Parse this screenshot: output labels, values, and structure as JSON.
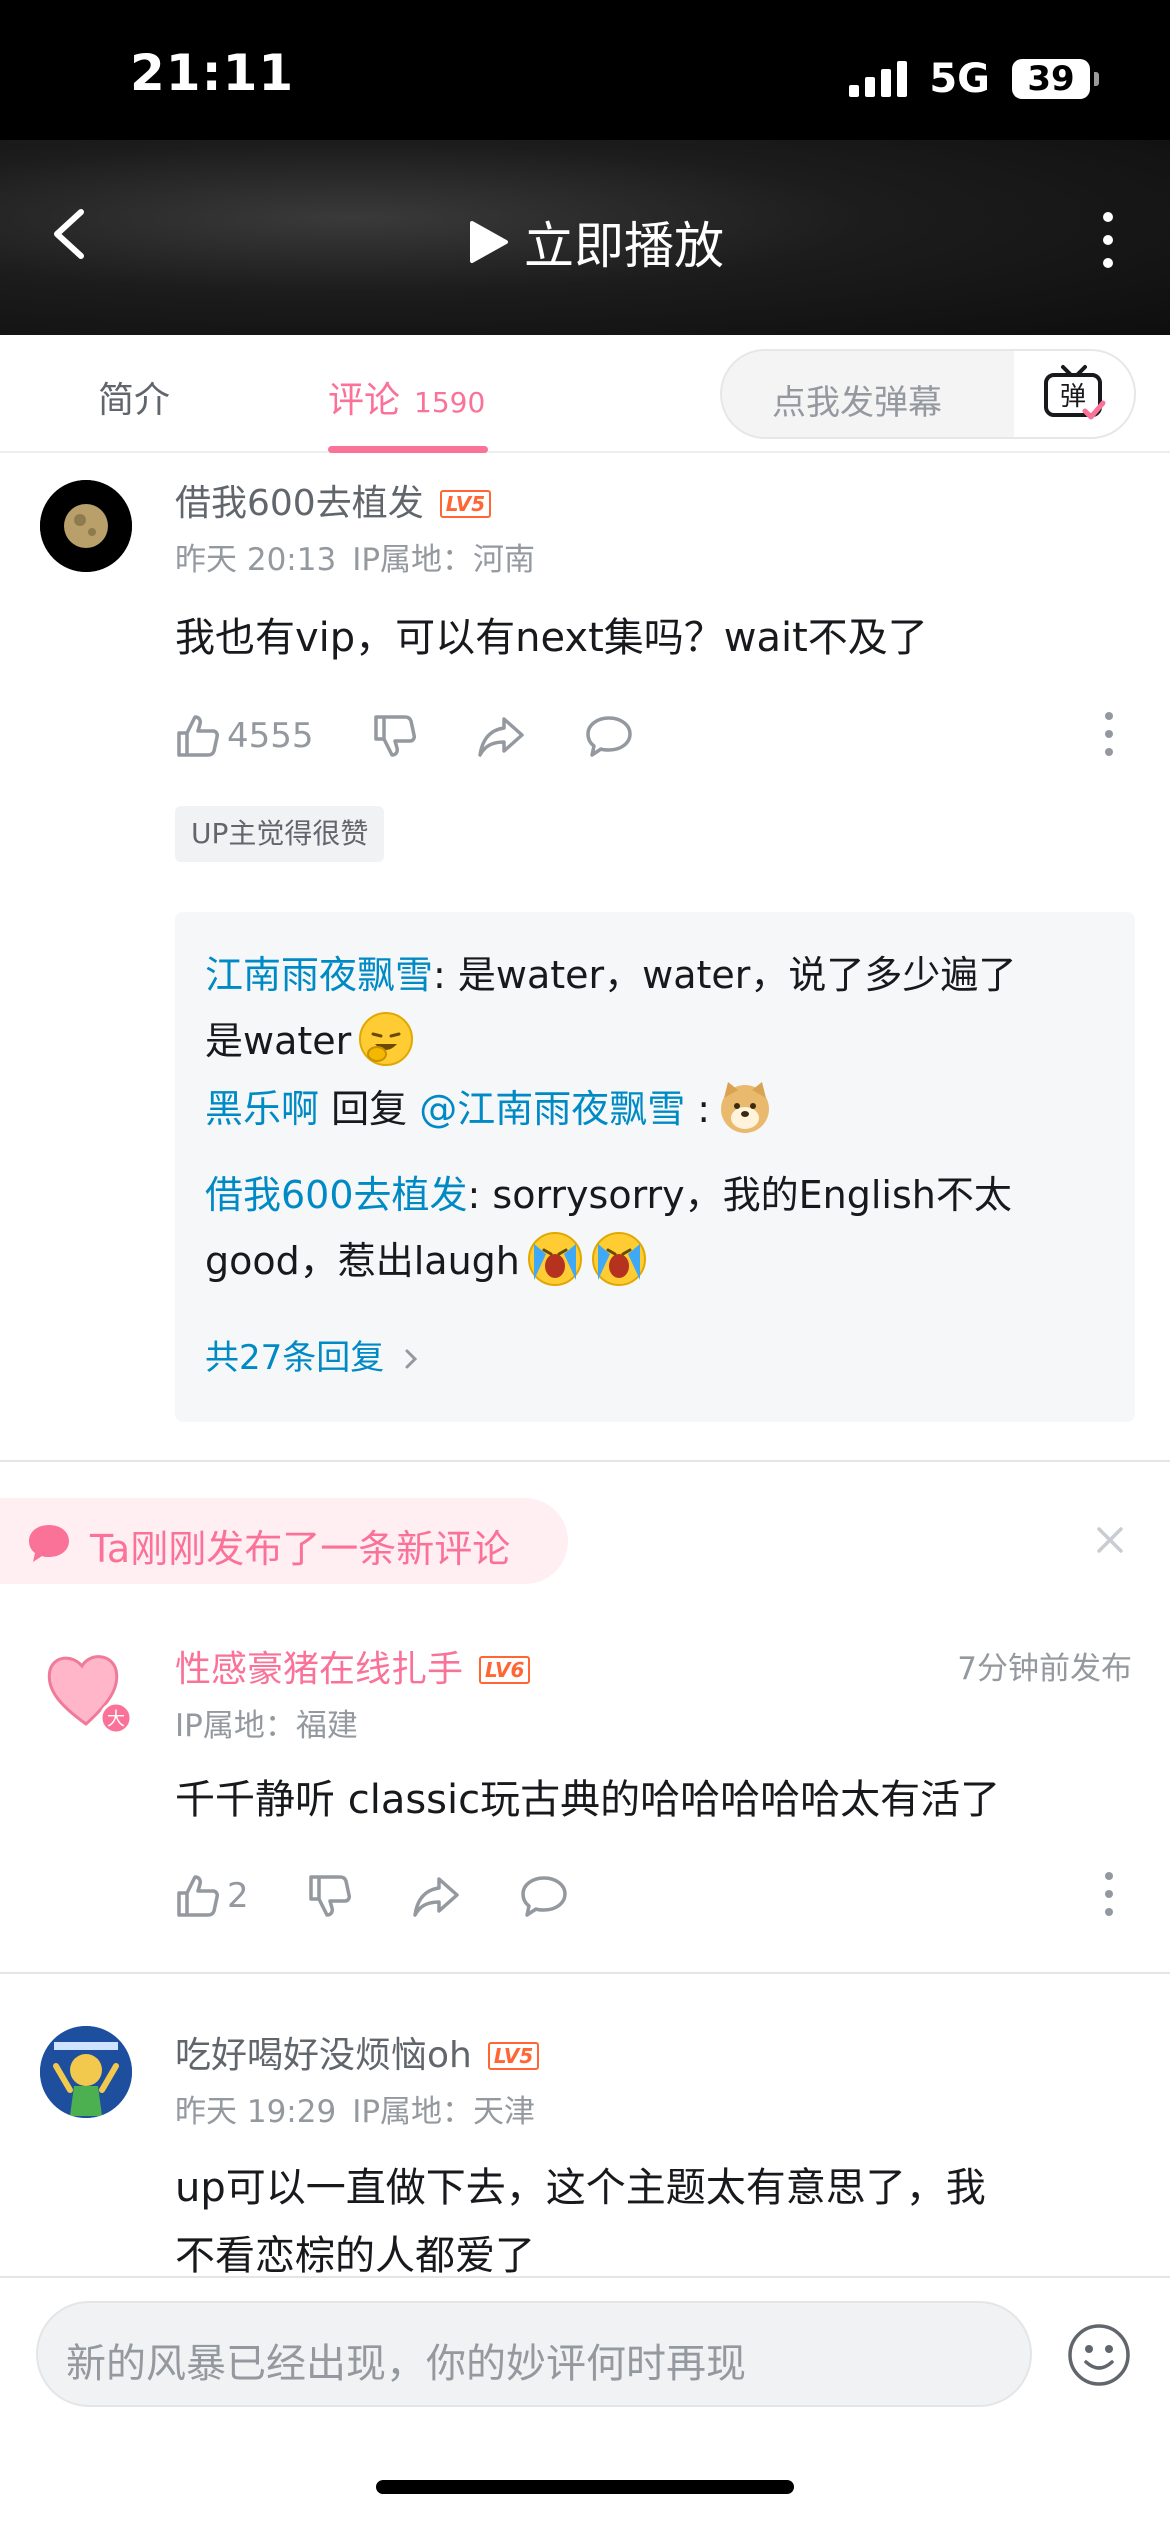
{
  "status_bar": {
    "time": "21:11",
    "network": "5G",
    "battery": "39"
  },
  "header": {
    "play_label": "立即播放"
  },
  "tabs": {
    "intro_label": "简介",
    "comments_label": "评论",
    "comments_count": "1590",
    "danmaku_placeholder": "点我发弹幕"
  },
  "comments": [
    {
      "username": "借我600去植发",
      "level": "LV5",
      "time": "昨天 20:13",
      "ip": "IP属地：河南",
      "text": "我也有vip，可以有next集吗？wait不及了",
      "likes": "4555",
      "up_badge": "UP主觉得很赞",
      "replies": [
        {
          "name": "江南雨夜飘雪",
          "text_line1": ": 是water，water，说了多少遍了",
          "text_line2": "是water"
        },
        {
          "name": "黑乐啊",
          "reply_word": " 回复 ",
          "mention": "@江南雨夜飘雪",
          "text": " :"
        },
        {
          "name": "借我600去植发",
          "text_line1": ": sorrysorry，我的English不太",
          "text_line2": "good，惹出laugh"
        }
      ],
      "reply_total": "共27条回复"
    },
    {
      "banner": "Ta刚刚发布了一条新评论",
      "username": "性感豪猪在线扎手",
      "level": "LV6",
      "posted": "7分钟前发布",
      "ip": "IP属地：福建",
      "text": "千千静听 classic玩古典的哈哈哈哈哈太有活了",
      "likes": "2"
    },
    {
      "username": "吃好喝好没烦恼oh",
      "level": "LV5",
      "time": "昨天 19:29",
      "ip": "IP属地：天津",
      "text_line1": "up可以一直做下去，这个主题太有意思了，我",
      "text_line2": "不看恋棕的人都爱了"
    }
  ],
  "input": {
    "placeholder": "新的风暴已经出现，你的妙评何时再现"
  },
  "colors": {
    "accent_pink": "#fb7299",
    "link_blue": "#008ac5",
    "level_orange": "#ff6633"
  }
}
